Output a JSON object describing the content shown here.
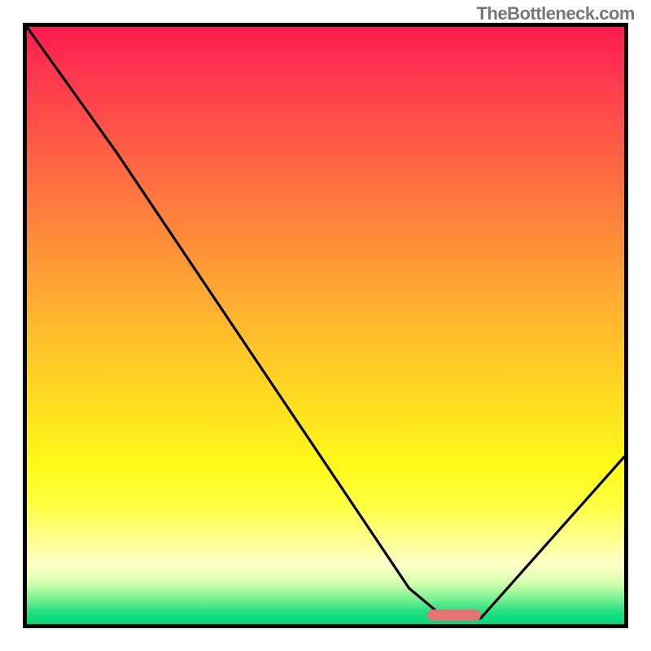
{
  "watermark": "TheBottleneck.com",
  "chart_data": {
    "type": "line",
    "title": "",
    "xlabel": "",
    "ylabel": "",
    "xlim": [
      0,
      100
    ],
    "ylim": [
      0,
      100
    ],
    "series": [
      {
        "name": "curve",
        "x": [
          0,
          15,
          64,
          70,
          76,
          100
        ],
        "y": [
          100,
          79,
          6,
          1,
          1,
          28
        ]
      }
    ],
    "highlight_range_x": [
      67,
      76
    ],
    "annotations": [],
    "grid": false,
    "legend": false,
    "colors": {
      "curve": "#000000",
      "marker": "#e57373",
      "gradient_top": "#ff1a4d",
      "gradient_bottom": "#00d878"
    }
  }
}
